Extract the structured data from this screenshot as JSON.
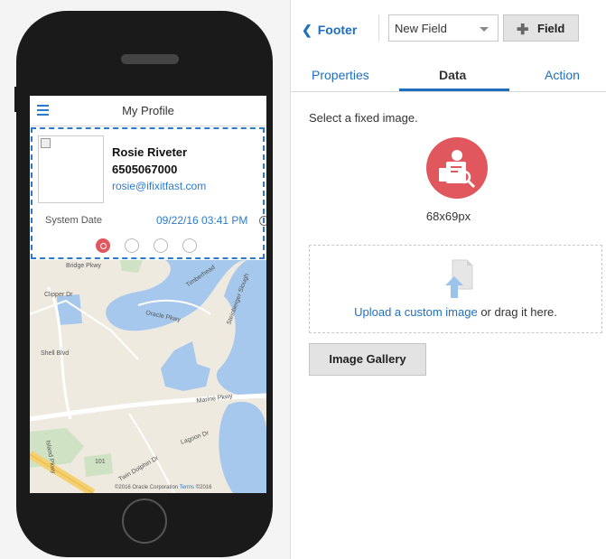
{
  "phone_preview": {
    "screen_title": "My Profile",
    "profile": {
      "name": "Rosie Riveter",
      "phone": "6505067000",
      "email": "rosie@ifixitfast.com"
    },
    "system_date": {
      "label": "System Date",
      "value": "09/22/16 03:41 PM"
    },
    "page_dots": {
      "count": 4,
      "active_index": 0
    },
    "map": {
      "street_labels": [
        "Timberhead",
        "Oracle Pkwy",
        "Steinberger Slough",
        "Clipper Dr",
        "Marine Pkwy",
        "Lagoon Dr",
        "Island Pkwy",
        "Shell Blvd",
        "Bridge Pkwy",
        "Twin Dolphin Dr",
        "101"
      ],
      "attribution": "©2016 Oracle Corporation",
      "terms_link": "Terms",
      "attribution_suffix": "©2016"
    }
  },
  "panel": {
    "back_label": "Footer",
    "field_select_value": "New Field",
    "add_field_label": "Field",
    "tabs": [
      {
        "label": "Properties",
        "active": false
      },
      {
        "label": "Data",
        "active": true
      },
      {
        "label": "Action",
        "active": false
      }
    ],
    "instruction": "Select a fixed image.",
    "image_size": "68x69px",
    "upload_link": "Upload a custom image",
    "upload_suffix": " or drag it here.",
    "gallery_button": "Image Gallery"
  },
  "colors": {
    "accent_blue": "#1f6fbf",
    "icon_red": "#e0585d",
    "phone_body": "#1a1a1a",
    "water_blue": "#a6c8ec",
    "land": "#eeeadf"
  }
}
